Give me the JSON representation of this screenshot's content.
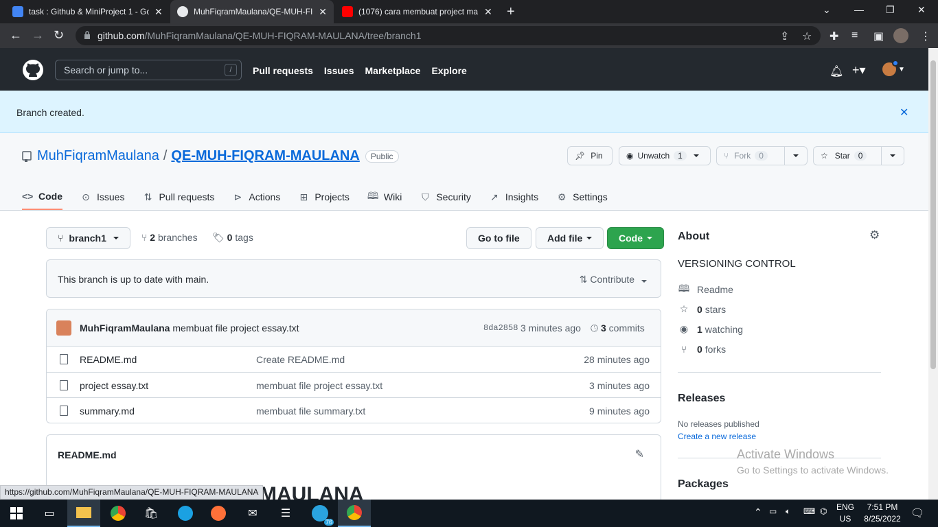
{
  "browser": {
    "tabs": [
      {
        "title": "task : Github & MiniProject 1 - Go",
        "icon": "google-docs-icon",
        "active": false
      },
      {
        "title": "MuhFiqramMaulana/QE-MUH-FIQRAM-MAULANA",
        "icon": "github-icon",
        "active": true
      },
      {
        "title": "(1076) cara membuat project ma",
        "icon": "youtube-icon",
        "active": false
      }
    ],
    "close_glyph": "✕",
    "new_tab_glyph": "+",
    "url_host": "github.com",
    "url_path": "/MuhFiqramMaulana/QE-MUH-FIQRAM-MAULANA/tree/branch1",
    "status_url": "https://github.com/MuhFiqramMaulana/QE-MUH-FIQRAM-MAULANA"
  },
  "github": {
    "search_placeholder": "Search or jump to...",
    "search_shortcut": "/",
    "nav": [
      "Pull requests",
      "Issues",
      "Marketplace",
      "Explore"
    ],
    "flash": "Branch created.",
    "owner": "MuhFiqramMaulana",
    "separator": "/",
    "repo": "QE-MUH-FIQRAM-MAULANA",
    "visibility": "Public",
    "actions": {
      "pin": "Pin",
      "unwatch": "Unwatch",
      "watch_count": "1",
      "fork": "Fork",
      "fork_count": "0",
      "star": "Star",
      "star_count": "0"
    },
    "tabs": [
      {
        "label": "Code",
        "icon": "code-icon",
        "selected": true
      },
      {
        "label": "Issues",
        "icon": "issue-icon"
      },
      {
        "label": "Pull requests",
        "icon": "pull-request-icon"
      },
      {
        "label": "Actions",
        "icon": "play-icon"
      },
      {
        "label": "Projects",
        "icon": "table-icon"
      },
      {
        "label": "Wiki",
        "icon": "book-icon"
      },
      {
        "label": "Security",
        "icon": "shield-icon"
      },
      {
        "label": "Insights",
        "icon": "graph-icon"
      },
      {
        "label": "Settings",
        "icon": "gear-icon"
      }
    ],
    "branch": "branch1",
    "branches_count": "2",
    "branches_label": "branches",
    "tags_count": "0",
    "tags_label": "tags",
    "go_to_file": "Go to file",
    "add_file": "Add file",
    "code_btn": "Code",
    "uptodate": "This branch is up to date with main.",
    "contribute": "Contribute",
    "commit": {
      "author": "MuhFiqramMaulana",
      "message": "membuat file project essay.txt",
      "sha": "8da2858",
      "time": "3 minutes ago",
      "commits_count": "3",
      "commits_label": "commits"
    },
    "files": [
      {
        "name": "README.md",
        "message": "Create README.md",
        "time": "28 minutes ago"
      },
      {
        "name": "project essay.txt",
        "message": "membuat file project essay.txt",
        "time": "3 minutes ago"
      },
      {
        "name": "summary.md",
        "message": "membuat file summary.txt",
        "time": "9 minutes ago"
      }
    ],
    "readme_title": "README.md",
    "readme_heading_partial": "MAULANA",
    "about": {
      "title": "About",
      "description": "VERSIONING CONTROL",
      "readme": "Readme",
      "stars_count": "0",
      "stars_label": "stars",
      "watching_count": "1",
      "watching_label": "watching",
      "forks_count": "0",
      "forks_label": "forks"
    },
    "releases": {
      "title": "Releases",
      "none": "No releases published",
      "create": "Create a new release"
    },
    "packages_title": "Packages"
  },
  "watermark": {
    "line1": "Activate Windows",
    "line2": "Go to Settings to activate Windows."
  },
  "taskbar": {
    "lang": "ENG",
    "region": "US",
    "time": "7:51 PM",
    "date": "8/25/2022",
    "telegram_badge": "76"
  }
}
